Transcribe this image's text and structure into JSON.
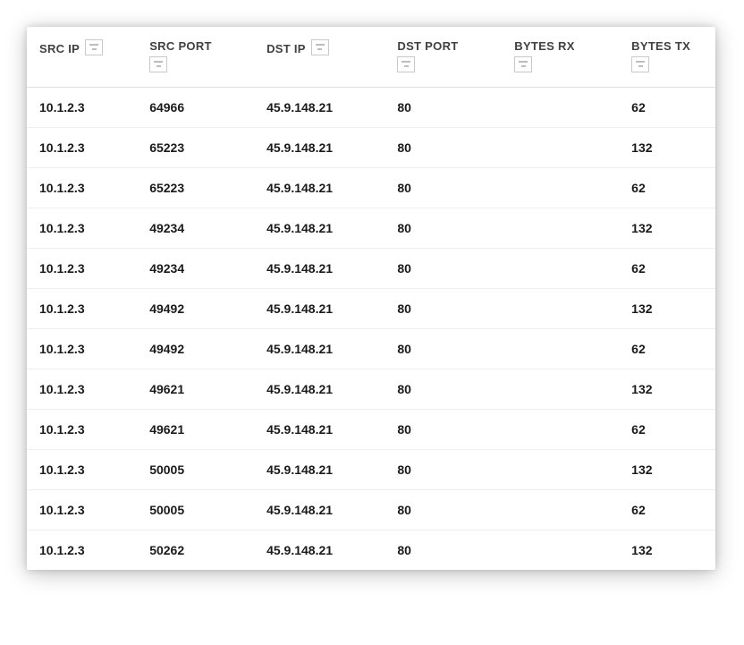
{
  "columns": [
    {
      "key": "src_ip",
      "label": "SRC IP"
    },
    {
      "key": "src_port",
      "label": "SRC PORT"
    },
    {
      "key": "dst_ip",
      "label": "DST IP"
    },
    {
      "key": "dst_port",
      "label": "DST PORT"
    },
    {
      "key": "bytes_rx",
      "label": "BYTES RX"
    },
    {
      "key": "bytes_tx",
      "label": "BYTES TX"
    }
  ],
  "rows": [
    {
      "src_ip": "10.1.2.3",
      "src_port": "64966",
      "dst_ip": "45.9.148.21",
      "dst_port": "80",
      "bytes_rx": "",
      "bytes_tx": "62"
    },
    {
      "src_ip": "10.1.2.3",
      "src_port": "65223",
      "dst_ip": "45.9.148.21",
      "dst_port": "80",
      "bytes_rx": "",
      "bytes_tx": "132"
    },
    {
      "src_ip": "10.1.2.3",
      "src_port": "65223",
      "dst_ip": "45.9.148.21",
      "dst_port": "80",
      "bytes_rx": "",
      "bytes_tx": "62"
    },
    {
      "src_ip": "10.1.2.3",
      "src_port": "49234",
      "dst_ip": "45.9.148.21",
      "dst_port": "80",
      "bytes_rx": "",
      "bytes_tx": "132"
    },
    {
      "src_ip": "10.1.2.3",
      "src_port": "49234",
      "dst_ip": "45.9.148.21",
      "dst_port": "80",
      "bytes_rx": "",
      "bytes_tx": "62"
    },
    {
      "src_ip": "10.1.2.3",
      "src_port": "49492",
      "dst_ip": "45.9.148.21",
      "dst_port": "80",
      "bytes_rx": "",
      "bytes_tx": "132"
    },
    {
      "src_ip": "10.1.2.3",
      "src_port": "49492",
      "dst_ip": "45.9.148.21",
      "dst_port": "80",
      "bytes_rx": "",
      "bytes_tx": "62"
    },
    {
      "src_ip": "10.1.2.3",
      "src_port": "49621",
      "dst_ip": "45.9.148.21",
      "dst_port": "80",
      "bytes_rx": "",
      "bytes_tx": "132"
    },
    {
      "src_ip": "10.1.2.3",
      "src_port": "49621",
      "dst_ip": "45.9.148.21",
      "dst_port": "80",
      "bytes_rx": "",
      "bytes_tx": "62"
    },
    {
      "src_ip": "10.1.2.3",
      "src_port": "50005",
      "dst_ip": "45.9.148.21",
      "dst_port": "80",
      "bytes_rx": "",
      "bytes_tx": "132"
    },
    {
      "src_ip": "10.1.2.3",
      "src_port": "50005",
      "dst_ip": "45.9.148.21",
      "dst_port": "80",
      "bytes_rx": "",
      "bytes_tx": "62"
    },
    {
      "src_ip": "10.1.2.3",
      "src_port": "50262",
      "dst_ip": "45.9.148.21",
      "dst_port": "80",
      "bytes_rx": "",
      "bytes_tx": "132"
    }
  ]
}
